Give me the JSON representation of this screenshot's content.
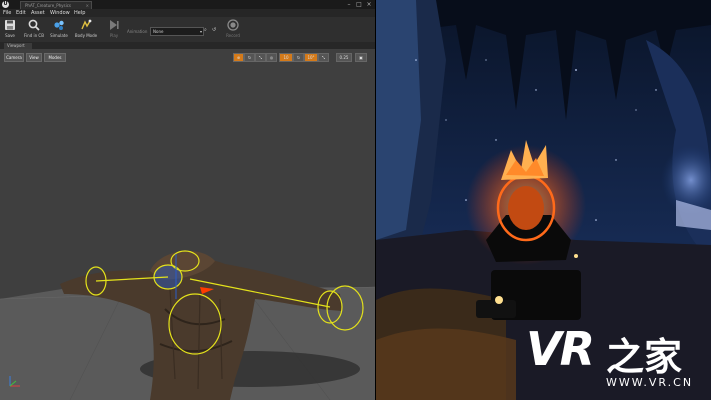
{
  "editor": {
    "logo": "U",
    "doc_tab": {
      "label": "PhAT_Creature_Physics",
      "close": "×"
    },
    "window_controls": {
      "minimize": "–",
      "maximize": "□",
      "close": "×"
    },
    "menu": [
      "File",
      "Edit",
      "Asset",
      "Window",
      "Help"
    ],
    "toolbar": {
      "buttons": [
        {
          "label": "Save",
          "icon": "save-icon",
          "enabled": true
        },
        {
          "label": "Find in CB",
          "icon": "magnifier-icon",
          "enabled": true
        },
        {
          "label": "Simulate",
          "icon": "simulate-icon",
          "enabled": true
        },
        {
          "label": "Body Mode",
          "icon": "body-mode-icon",
          "enabled": true
        },
        {
          "label": "Play",
          "icon": "play-icon",
          "enabled": false
        },
        {
          "label": "Record",
          "icon": "record-icon",
          "enabled": false
        }
      ],
      "animation_label": "Animation",
      "animation_value": "None",
      "browse_icon": "⌕",
      "reset_icon": "↺"
    },
    "viewport_tab": {
      "label": "Viewport"
    },
    "viewport": {
      "camera_button": "Camera",
      "view_button": "View",
      "mode_button": "Modes",
      "tools": [
        "⊕",
        "↻",
        "⤡",
        "◎",
        "10",
        "↻",
        "10°",
        "⤡",
        "0.25",
        "▣"
      ]
    }
  },
  "colors": {
    "editor_bg": "#3b3b3b",
    "toolbar_bg": "#2f2f2f",
    "floor": "#5a5a5a",
    "physics_body": "#e4e21b",
    "selection": "#2a5dc8",
    "joint_marker": "#ff3b00",
    "fire": "#ff6a1a",
    "cave_blue": "#1a3e80"
  },
  "watermark": {
    "mark": "VR",
    "brand": "之家",
    "url": "WWW.VR.CN"
  }
}
